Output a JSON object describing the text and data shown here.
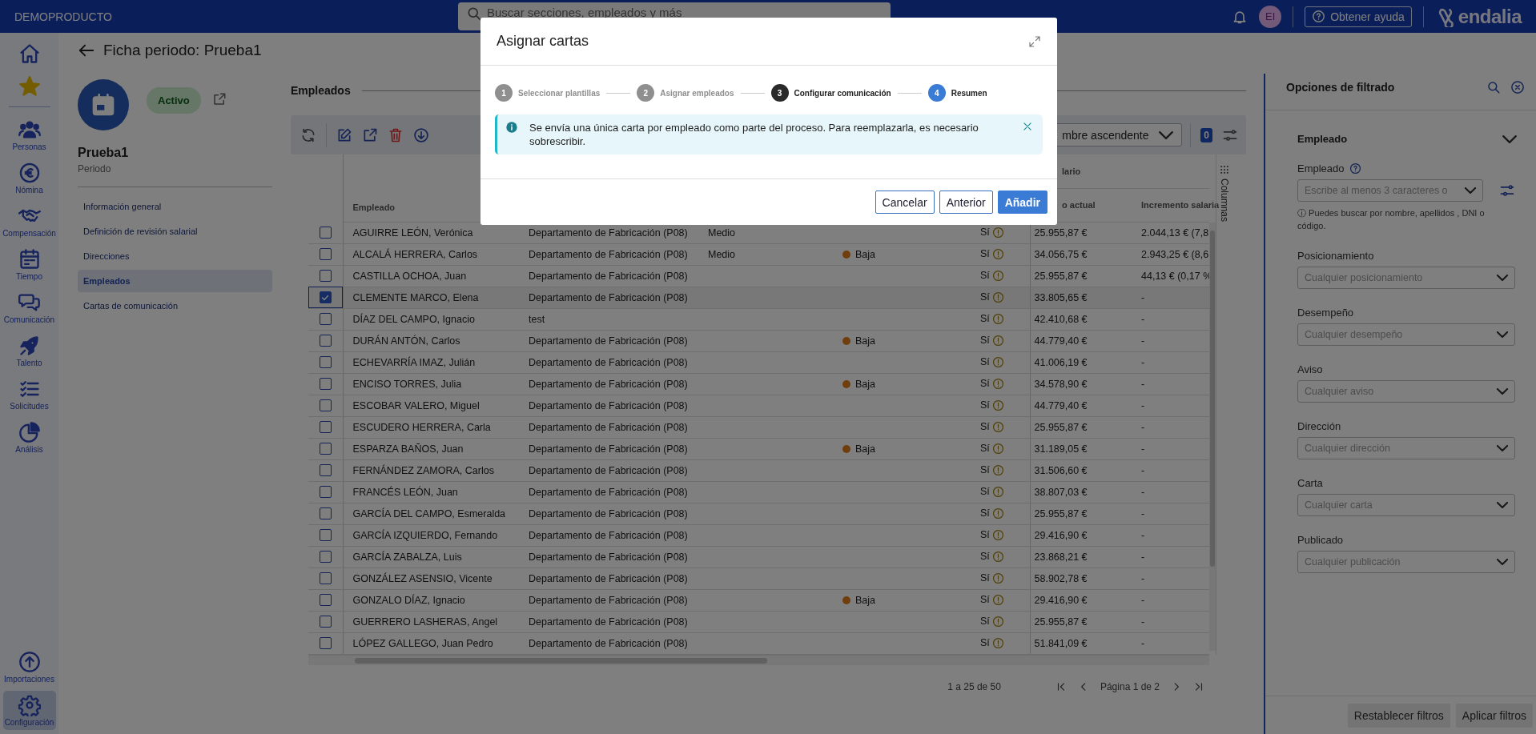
{
  "top_bar": {
    "brand": "DEMOPRODUCTO",
    "search": {
      "placeholder": "Buscar secciones, empleados y más"
    },
    "avatar": "EI",
    "help_button": "Obtener ayuda",
    "logo": "endalia"
  },
  "nav": {
    "items": [
      {
        "kind": "home",
        "selected": false
      },
      {
        "kind": "favorites",
        "selected": false
      },
      {
        "kind": "people",
        "label": "Personas",
        "selected": false
      },
      {
        "kind": "payroll",
        "label": "Nómina",
        "selected": false
      },
      {
        "kind": "compensation",
        "label": "Compensación",
        "selected": false
      },
      {
        "kind": "time",
        "label": "Tiempo",
        "selected": false
      },
      {
        "kind": "communication",
        "label": "Comunicación",
        "selected": false
      },
      {
        "kind": "talent",
        "label": "Talento",
        "selected": false
      },
      {
        "kind": "requests",
        "label": "Solicitudes",
        "selected": false
      },
      {
        "kind": "analytics",
        "label": "Análisis",
        "selected": false
      }
    ],
    "bottom_items": [
      {
        "kind": "imports",
        "label": "Importaciones",
        "selected": false
      },
      {
        "kind": "settings",
        "label": "Configuración",
        "selected": true
      }
    ]
  },
  "page": {
    "title": "Ficha periodo: Prueba1"
  },
  "record": {
    "status": "Activo",
    "name": "Prueba1",
    "type": "Periodo",
    "menu": [
      {
        "label": "Información general",
        "selected": false
      },
      {
        "label": "Definición de revisión salarial",
        "selected": false
      },
      {
        "label": "Direcciones",
        "selected": false
      },
      {
        "label": "Empleados",
        "selected": true
      },
      {
        "label": "Cartas de comunicación",
        "selected": false
      }
    ]
  },
  "section": {
    "title": "Empleados",
    "sort": "mbre ascendente",
    "filter_count": "0"
  },
  "table": {
    "group_header": "lario",
    "columns": [
      "Empleado",
      "o actual",
      "Incremento salaria"
    ],
    "side_tab": "Columnas",
    "rows": [
      {
        "checked": false,
        "name": "AGUIRRE LEÓN, Verónica",
        "column_2": "Departamento de Fabricación (P08)",
        "column_3": "Medio",
        "column_5": "Sí",
        "column_6": "25.955,87 €",
        "column_7": "2.044,13 € (7,8"
      },
      {
        "checked": false,
        "name": "ALCALÁ HERRERA, Carlos",
        "column_2": "Departamento de Fabricación (P08)",
        "column_3": "Medio",
        "column_4": "Baja",
        "column_5": "Sí",
        "column_6": "34.056,75 €",
        "column_7": "2.943,25 € (8,6"
      },
      {
        "checked": false,
        "name": "CASTILLA OCHOA, Juan",
        "column_2": "Departamento de Fabricación (P08)",
        "column_5": "Sí",
        "column_6": "25.955,87 €",
        "column_7": "44,13 € (0,17 %"
      },
      {
        "checked": true,
        "name": "CLEMENTE MARCO, Elena",
        "column_2": "Departamento de Fabricación (P08)",
        "column_5": "Sí",
        "column_6": "33.805,65 €",
        "column_7": "-"
      },
      {
        "checked": false,
        "name": "DÍAZ DEL CAMPO, Ignacio",
        "column_2": "test",
        "column_5": "Sí",
        "column_6": "42.410,68 €",
        "column_7": "-"
      },
      {
        "checked": false,
        "name": "DURÁN ANTÓN, Carlos",
        "column_2": "Departamento de Fabricación (P08)",
        "column_4": "Baja",
        "column_5": "Sí",
        "column_6": "44.779,40 €",
        "column_7": "-"
      },
      {
        "checked": false,
        "name": "ECHEVARRÍA IMAZ, Julián",
        "column_2": "Departamento de Fabricación (P08)",
        "column_5": "Sí",
        "column_6": "41.006,19 €",
        "column_7": "-"
      },
      {
        "checked": false,
        "name": "ENCISO TORRES, Julia",
        "column_2": "Departamento de Fabricación (P08)",
        "column_4": "Baja",
        "column_5": "Sí",
        "column_6": "34.578,90 €",
        "column_7": "-"
      },
      {
        "checked": false,
        "name": "ESCOBAR VALERO, Miguel",
        "column_2": "Departamento de Fabricación (P08)",
        "column_5": "Sí",
        "column_6": "44.779,40 €",
        "column_7": "-"
      },
      {
        "checked": false,
        "name": "ESCUDERO HERRERA, Carla",
        "column_2": "Departamento de Fabricación (P08)",
        "column_5": "Sí",
        "column_6": "25.955,87 €",
        "column_7": "-"
      },
      {
        "checked": false,
        "name": "ESPARZA BAÑOS, Juan",
        "column_2": "Departamento de Fabricación (P08)",
        "column_4": "Baja",
        "column_5": "Sí",
        "column_6": "31.189,05 €",
        "column_7": "-"
      },
      {
        "checked": false,
        "name": "FERNÁNDEZ ZAMORA, Carlos",
        "column_2": "Departamento de Fabricación (P08)",
        "column_5": "Sí",
        "column_6": "31.506,60 €",
        "column_7": "-"
      },
      {
        "checked": false,
        "name": "FRANCÉS LEÓN, Juan",
        "column_2": "Departamento de Fabricación (P08)",
        "column_5": "Sí",
        "column_6": "38.807,03 €",
        "column_7": "-"
      },
      {
        "checked": false,
        "name": "GARCÍA DEL CAMPO, Esmeralda",
        "column_2": "Departamento de Fabricación (P08)",
        "column_5": "Sí",
        "column_6": "25.955,87 €",
        "column_7": "-"
      },
      {
        "checked": false,
        "name": "GARCÍA IZQUIERDO, Fernando",
        "column_2": "Departamento de Fabricación (P08)",
        "column_5": "Sí",
        "column_6": "29.416,90 €",
        "column_7": "-"
      },
      {
        "checked": false,
        "name": "GARCÍA ZABALZA, Luis",
        "column_2": "Departamento de Fabricación (P08)",
        "column_5": "Sí",
        "column_6": "23.868,21 €",
        "column_7": "-"
      },
      {
        "checked": false,
        "name": "GONZÁLEZ ASENSIO, Vicente",
        "column_2": "Departamento de Fabricación (P08)",
        "column_5": "Sí",
        "column_6": "58.902,78 €",
        "column_7": "-"
      },
      {
        "checked": false,
        "name": "GONZALO DÍAZ, Ignacio",
        "column_2": "Departamento de Fabricación (P08)",
        "column_4": "Baja",
        "column_5": "Sí",
        "column_6": "29.416,90 €",
        "column_7": "-"
      },
      {
        "checked": false,
        "name": "GUERRERO LASHERAS, Angel",
        "column_2": "Departamento de Fabricación (P08)",
        "column_5": "Sí",
        "column_6": "25.955,87 €",
        "column_7": "-"
      },
      {
        "checked": false,
        "name": "LÓPEZ GALLEGO, Juan Pedro",
        "column_2": "Departamento de Fabricación (P08)",
        "column_5": "Sí",
        "column_6": "51.841,09 €",
        "column_7": "-"
      }
    ]
  },
  "pagination": {
    "range": "1 a 25 de 50",
    "page": "Página 1 de 2"
  },
  "filters": {
    "title": "Opciones de filtrado",
    "section": "Empleado",
    "employee": {
      "label": "Empleado",
      "placeholder": "Escribe al menos 3 caracteres o",
      "hint": "ⓘ Puedes buscar por nombre, apellidos , DNI o código."
    },
    "fields": [
      {
        "label": "Posicionamiento",
        "placeholder": "Cualquier posicionamiento"
      },
      {
        "label": "Desempeño",
        "placeholder": "Cualquier desempeño"
      },
      {
        "label": "Aviso",
        "placeholder": "Cualquier aviso"
      },
      {
        "label": "Dirección",
        "placeholder": "Cualquier dirección"
      },
      {
        "label": "Carta",
        "placeholder": "Cualquier carta"
      },
      {
        "label": "Publicado",
        "placeholder": "Cualquier publicación"
      }
    ],
    "buttons": [
      "Restablecer filtros",
      "Aplicar filtros"
    ]
  },
  "modal": {
    "title": "Asignar cartas",
    "steps": [
      {
        "number": "1",
        "label": "Seleccionar plantillas",
        "completed": true,
        "current": false
      },
      {
        "number": "2",
        "label": "Asignar empleados",
        "completed": true,
        "current": false
      },
      {
        "number": "3",
        "label": "Configurar comunicación",
        "completed": false,
        "current": true
      },
      {
        "number": "4",
        "label": "Resumen",
        "completed": false,
        "current": false
      }
    ],
    "alert": "Se envía una única carta por empleado como parte del proceso. Para reemplazarla, es necesario sobrescribir.",
    "buttons": [
      {
        "label": "Cancelar",
        "kind": "secondary"
      },
      {
        "label": "Anterior",
        "kind": "secondary"
      },
      {
        "label": "Añadir",
        "kind": "primary"
      }
    ]
  }
}
